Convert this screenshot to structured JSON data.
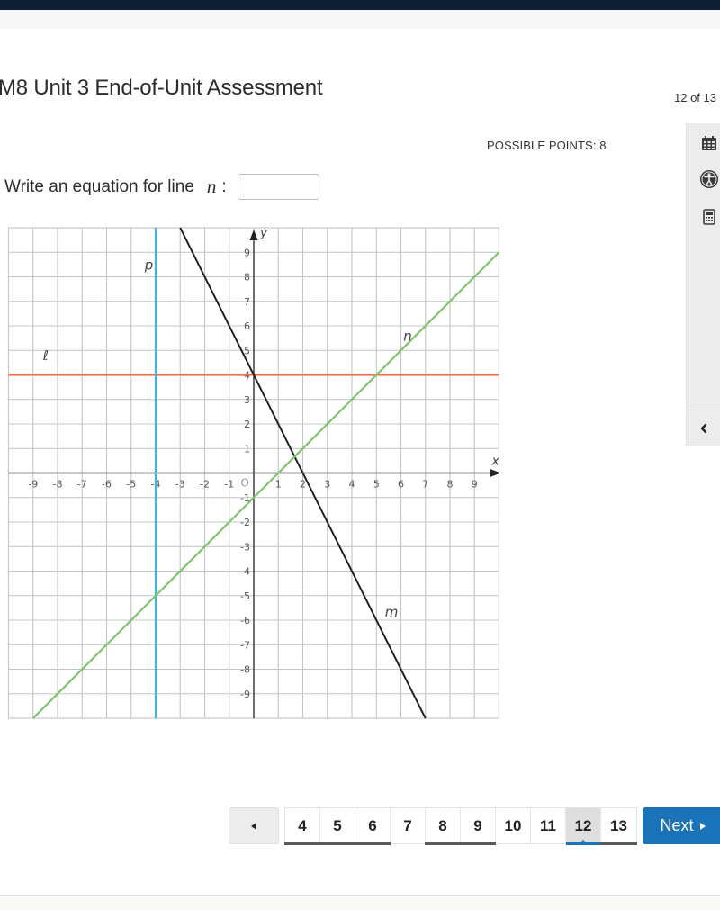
{
  "header": {
    "title": "M8 Unit 3 End-of-Unit Assessment",
    "progress": "12 of 13",
    "possible_points": "POSSIBLE POINTS: 8"
  },
  "question": {
    "prompt": "Write an equation for line",
    "variable": "n",
    "colon": ":",
    "answer_value": "",
    "answer_placeholder": ""
  },
  "toolrail": {
    "tools": [
      {
        "name": "calendar-icon",
        "label": "Calendar"
      },
      {
        "name": "accessibility-icon",
        "label": "Accessibility"
      },
      {
        "name": "calculator-icon",
        "label": "Calculator"
      }
    ],
    "collapse_icon": "chevron-left-icon"
  },
  "chart_data": {
    "type": "line",
    "title": "",
    "xlabel": "x",
    "ylabel": "y",
    "xlim": [
      -10,
      10
    ],
    "ylim": [
      -10,
      10
    ],
    "grid": true,
    "x_ticks": [
      -9,
      -8,
      -7,
      -6,
      -5,
      -4,
      -3,
      -2,
      -1,
      1,
      2,
      3,
      4,
      5,
      6,
      7,
      8,
      9
    ],
    "y_ticks": [
      -9,
      -8,
      -7,
      -6,
      -5,
      -4,
      -3,
      -2,
      -1,
      1,
      2,
      3,
      4,
      5,
      6,
      7,
      8,
      9
    ],
    "origin_label": "O",
    "series": [
      {
        "name": "ℓ",
        "kind": "horizontal",
        "equation": "y = 4",
        "color": "#f07050",
        "points": [
          [
            -10,
            4
          ],
          [
            10,
            4
          ]
        ],
        "label_at": [
          -8.6,
          4.6
        ]
      },
      {
        "name": "p",
        "kind": "vertical",
        "equation": "x = -4",
        "color": "#3fb3e0",
        "points": [
          [
            -4,
            10
          ],
          [
            -4,
            -10
          ]
        ],
        "label_at": [
          -4.45,
          8.3
        ]
      },
      {
        "name": "m",
        "kind": "line",
        "equation": "y = -2x + 4",
        "color": "#222222",
        "points": [
          [
            -3,
            10
          ],
          [
            7,
            -10
          ]
        ],
        "label_at": [
          5.35,
          -5.85
        ]
      },
      {
        "name": "n",
        "kind": "line",
        "equation": "y = x - 1",
        "color": "#7cc36a",
        "points": [
          [
            -9,
            -10
          ],
          [
            10,
            9
          ]
        ],
        "label_at": [
          6.1,
          5.4
        ]
      }
    ]
  },
  "pagination": {
    "prev_icon": "triangle-left-icon",
    "pages": [
      {
        "label": "4",
        "state": "answered"
      },
      {
        "label": "5",
        "state": "answered"
      },
      {
        "label": "6",
        "state": "answered"
      },
      {
        "label": "7",
        "state": "unanswered"
      },
      {
        "label": "8",
        "state": "answered"
      },
      {
        "label": "9",
        "state": "answered"
      },
      {
        "label": "10",
        "state": "unanswered"
      },
      {
        "label": "11",
        "state": "unanswered"
      },
      {
        "label": "12",
        "state": "current"
      },
      {
        "label": "13",
        "state": "answered"
      }
    ],
    "next_label": "Next",
    "next_icon": "triangle-right-icon",
    "accent_color": "#1a73b8"
  }
}
